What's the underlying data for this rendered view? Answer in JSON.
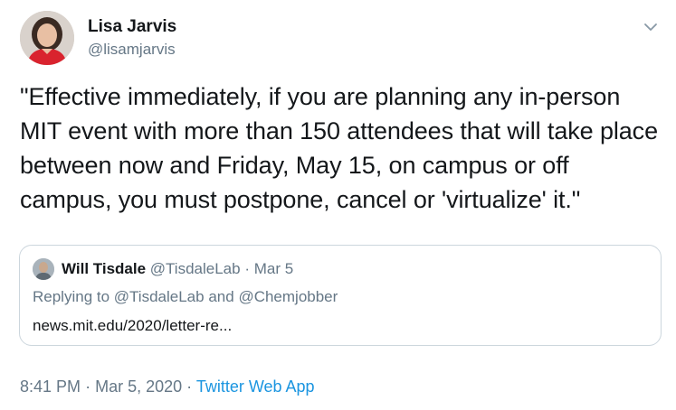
{
  "author": {
    "name": "Lisa Jarvis",
    "handle": "@lisamjarvis",
    "avatar_icon": "profile-photo"
  },
  "tweet": {
    "text": "\"Effective immediately, if you are planning any in-person MIT event with more than 150 attendees that will take place between now and Friday, May 15, on campus or off campus, you must postpone, cancel or 'virtualize' it.\""
  },
  "quoted_tweet": {
    "name": "Will Tisdale",
    "handle": "@TisdaleLab",
    "separator": "·",
    "date": "Mar 5",
    "reply_prefix": "Replying to",
    "reply_to_1": "@TisdaleLab",
    "reply_and": "and",
    "reply_to_2": "@Chemjobber",
    "link": "news.mit.edu/2020/letter-re..."
  },
  "meta": {
    "time": "8:41 PM",
    "sep1": "·",
    "date": "Mar 5, 2020",
    "sep2": "·",
    "app": "Twitter Web App"
  },
  "colors": {
    "text": "#14171a",
    "secondary": "#657786",
    "link": "#1b95e0",
    "border": "#ccd6dd"
  }
}
